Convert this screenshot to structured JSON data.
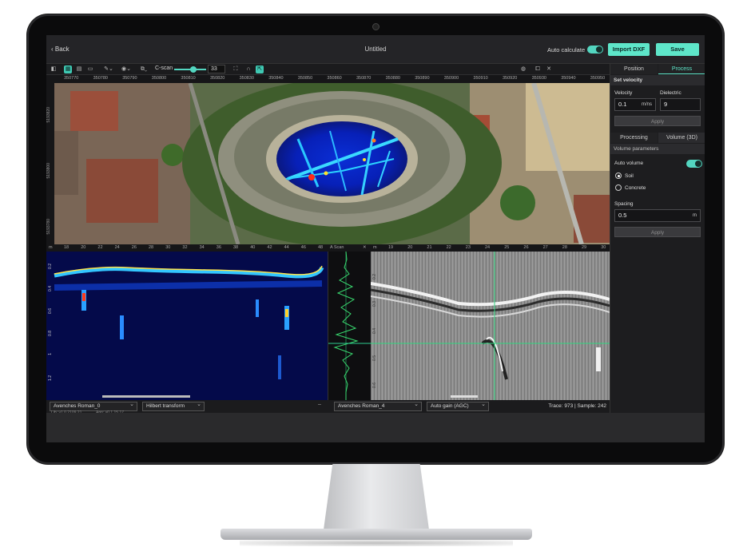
{
  "header": {
    "back_label": "Back",
    "title": "Untitled",
    "auto_calculate_label": "Auto calculate",
    "import_button": "Import DXF",
    "save_button": "Save"
  },
  "toolbar": {
    "cscan_label": "C-scan",
    "cscan_value": "33"
  },
  "map_ruler": {
    "x_ticks": [
      "350770",
      "350780",
      "350790",
      "350800",
      "350810",
      "350820",
      "350830",
      "350840",
      "350850",
      "350860",
      "350870",
      "350880",
      "350890",
      "350900",
      "350910",
      "350920",
      "350930",
      "350940",
      "350950"
    ],
    "y_ticks": [
      "5193820",
      "5193800",
      "5193780"
    ]
  },
  "bscan": {
    "ruler_unit": "m",
    "x_ticks": [
      "18",
      "20",
      "22",
      "24",
      "26",
      "28",
      "30",
      "32",
      "34",
      "36",
      "38",
      "40",
      "42",
      "44",
      "46",
      "48"
    ],
    "y_ticks": [
      "0.2",
      "0.4",
      "0.6",
      "0.8",
      "1",
      "1.2"
    ],
    "dataset": "Avenches Roman_0",
    "transform": "Hilbert transform",
    "lib_version": "Lib: v1.0.2109.21",
    "app_version": "App: v0.1.15.17",
    "minimize": "–"
  },
  "ascan": {
    "label": "A Scan",
    "close": "✕"
  },
  "gray_scan": {
    "ruler_unit": "m",
    "x_ticks": [
      "19",
      "20",
      "21",
      "22",
      "23",
      "24",
      "25",
      "26",
      "27",
      "28",
      "29",
      "30"
    ],
    "y_ticks": [
      "0.2",
      "0.3",
      "0.4",
      "0.5",
      "0.6"
    ],
    "dataset": "Avenches Roman_4",
    "gain": "Auto gain (AGC)",
    "status": "Trace: 973 | Sample: 242"
  },
  "right_panel": {
    "tabs": [
      "Position",
      "Process"
    ],
    "active_tab": 1,
    "set_velocity": "Set velocity",
    "velocity_label": "Velocity",
    "velocity_value": "0.1",
    "velocity_unit": "m/ns",
    "dielectric_label": "Dielectric",
    "dielectric_value": "9",
    "apply_label": "Apply",
    "subtabs": [
      "Processing",
      "Volume (3D)"
    ],
    "active_subtab": 1,
    "volume_parameters": "Volume parameters",
    "auto_volume_label": "Auto volume",
    "radio_soil": "Soil",
    "radio_concrete": "Concrete",
    "spacing_label": "Spacing",
    "spacing_value": "0.5",
    "spacing_unit": "m",
    "apply2_label": "Apply"
  },
  "colors": {
    "accent": "#5ee6c9",
    "background": "#1f1f21"
  }
}
